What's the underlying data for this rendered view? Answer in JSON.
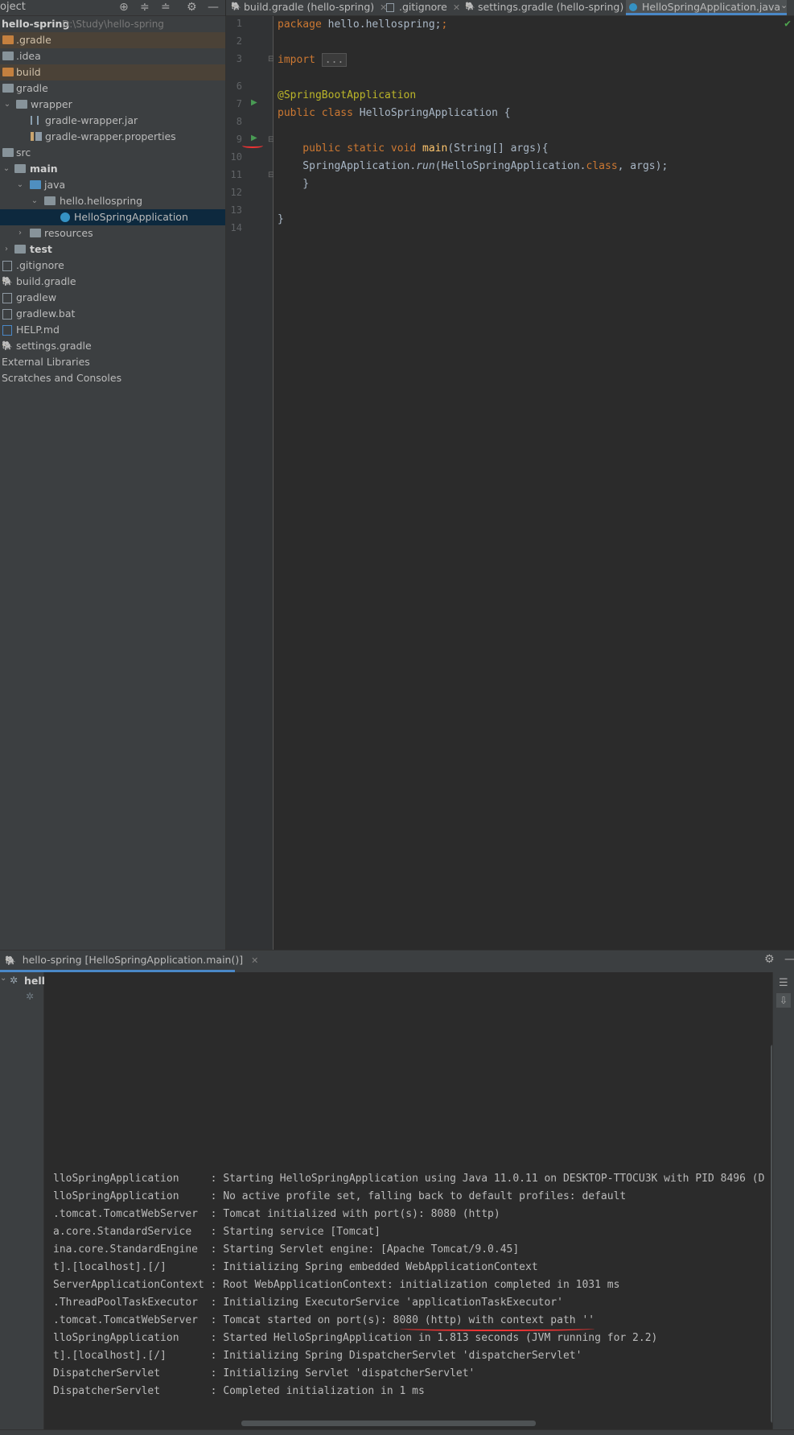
{
  "project_panel": {
    "title": "oject",
    "root": {
      "name": "hello-spring",
      "path": "D:\\Study\\hello-spring"
    },
    "items": [
      {
        "label": ".gradle"
      },
      {
        "label": ".idea"
      },
      {
        "label": "build"
      },
      {
        "label": "gradle"
      },
      {
        "label": "wrapper"
      },
      {
        "label": "gradle-wrapper.jar"
      },
      {
        "label": "gradle-wrapper.properties"
      },
      {
        "label": "src"
      },
      {
        "label": "main"
      },
      {
        "label": "java"
      },
      {
        "label": "hello.hellospring"
      },
      {
        "label": "HelloSpringApplication"
      },
      {
        "label": "resources"
      },
      {
        "label": "test"
      },
      {
        "label": ".gitignore"
      },
      {
        "label": "build.gradle"
      },
      {
        "label": "gradlew"
      },
      {
        "label": "gradlew.bat"
      },
      {
        "label": "HELP.md"
      },
      {
        "label": "settings.gradle"
      },
      {
        "label": "External Libraries"
      },
      {
        "label": "Scratches and Consoles"
      }
    ]
  },
  "editor": {
    "tabs": [
      {
        "label": "build.gradle (hello-spring)"
      },
      {
        "label": ".gitignore"
      },
      {
        "label": "settings.gradle (hello-spring)"
      },
      {
        "label": "HelloSpringApplication.java"
      }
    ],
    "line_numbers": [
      "1",
      "2",
      "3",
      "6",
      "7",
      "8",
      "9",
      "10",
      "11",
      "12",
      "13",
      "14"
    ],
    "code": {
      "l1_kw": "package",
      "l1_rest": " hello.hellospring;",
      "l3_kw": "import",
      "l3_fold": "...",
      "l6_ann": "@SpringBootApplication",
      "l7_kw": "public class",
      "l7_rest": " HelloSpringApplication {",
      "l9_kw": "    public static void",
      "l9_fn": " main",
      "l9_rest": "(String[] args){",
      "l10_a": "    SpringApplication.",
      "l10_run": "run",
      "l10_b": "(HelloSpringApplication.",
      "l10_kw": "class",
      "l10_c": ", args);",
      "l11": "    }",
      "l13": "}"
    }
  },
  "run_panel": {
    "tab_label": "hello-spring [HelloSpringApplication.main()]",
    "tree_root": "hello",
    "console_lines": [
      "lloSpringApplication     : Starting HelloSpringApplication using Java 11.0.11 on DESKTOP-TTOCU3K with PID 8496 (D",
      "lloSpringApplication     : No active profile set, falling back to default profiles: default",
      ".tomcat.TomcatWebServer  : Tomcat initialized with port(s): 8080 (http)",
      "a.core.StandardService   : Starting service [Tomcat]",
      "ina.core.StandardEngine  : Starting Servlet engine: [Apache Tomcat/9.0.45]",
      "t].[localhost].[/]       : Initializing Spring embedded WebApplicationContext",
      "ServerApplicationContext : Root WebApplicationContext: initialization completed in 1031 ms",
      ".ThreadPoolTaskExecutor  : Initializing ExecutorService 'applicationTaskExecutor'",
      ".tomcat.TomcatWebServer  : Tomcat started on port(s): 8080 (http) with context path ''",
      "lloSpringApplication     : Started HelloSpringApplication in 1.813 seconds (JVM running for 2.2)",
      "t].[localhost].[/]       : Initializing Spring DispatcherServlet 'dispatcherServlet'",
      "DispatcherServlet        : Initializing Servlet 'dispatcherServlet'",
      "DispatcherServlet        : Completed initialization in 1 ms"
    ]
  },
  "icons": {
    "header_toolbar": [
      "target-icon",
      "expand-all-icon",
      "collapse-all-icon",
      "gear-icon",
      "minimize-icon"
    ],
    "run_gutter": "run-arrow-icon"
  }
}
